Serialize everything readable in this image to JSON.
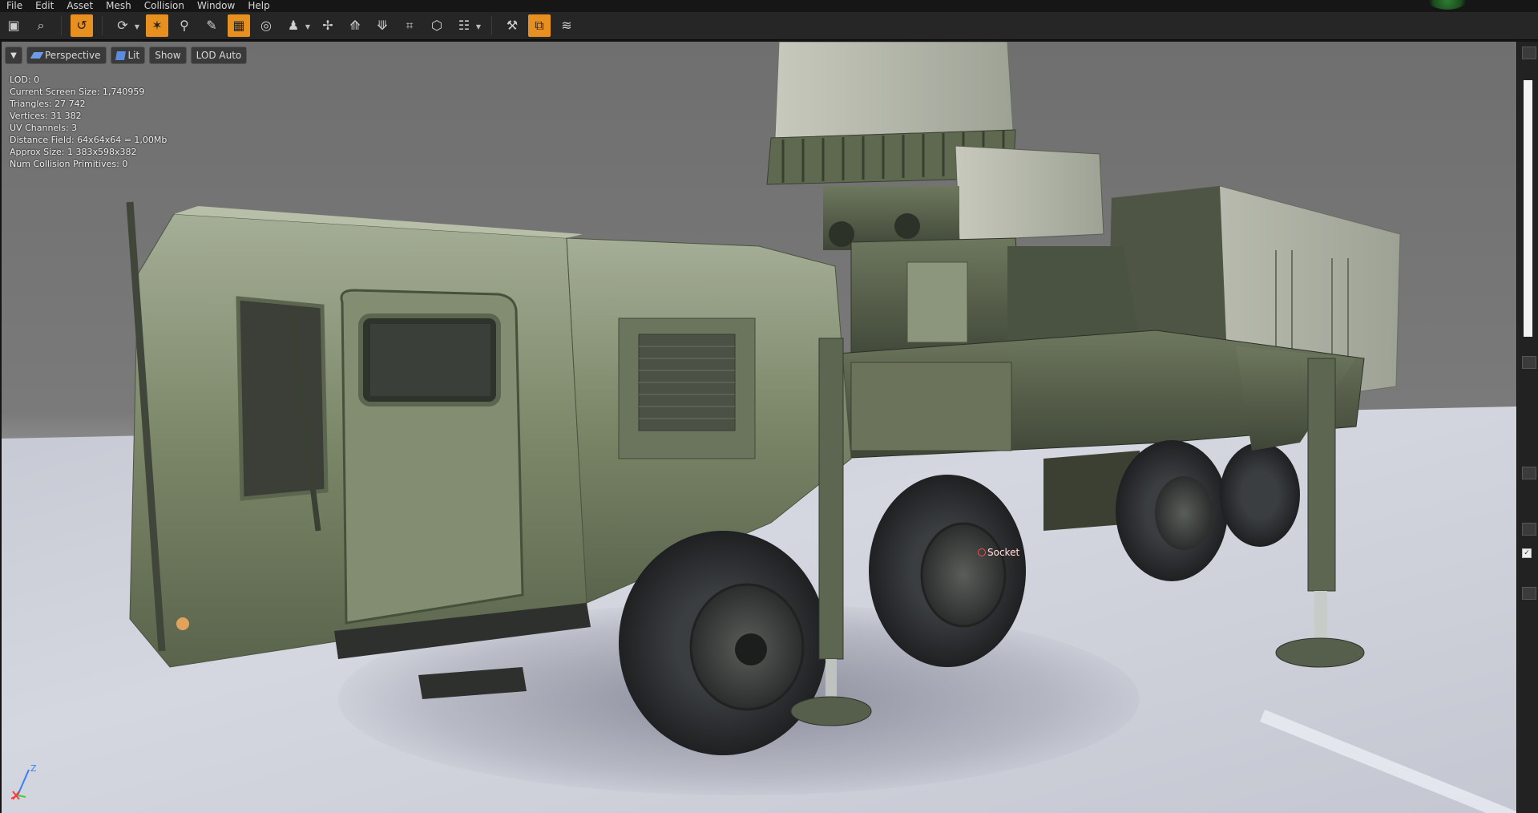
{
  "menu": [
    "File",
    "Edit",
    "Asset",
    "Mesh",
    "Collision",
    "Window",
    "Help"
  ],
  "toolbar": {
    "buttons": [
      {
        "name": "save-icon",
        "glyph": "▣",
        "active": false
      },
      {
        "name": "find-in-content-browser-icon",
        "glyph": "⌕",
        "active": false
      },
      {
        "name": "reimport-icon",
        "glyph": "↺",
        "active": true
      },
      {
        "name": "camera-orbit-icon",
        "glyph": "⟳",
        "active": false,
        "dropdown": true
      },
      {
        "name": "sockets-icon",
        "glyph": "✶",
        "active": true
      },
      {
        "name": "pivot-icon",
        "glyph": "⚲",
        "active": false
      },
      {
        "name": "edit-paint-icon",
        "glyph": "✎",
        "active": false
      },
      {
        "name": "grid-icon",
        "glyph": "▦",
        "active": true
      },
      {
        "name": "bounds-icon",
        "glyph": "◎",
        "active": false
      },
      {
        "name": "collision-icon",
        "glyph": "♟",
        "active": false,
        "dropdown": true
      },
      {
        "name": "normals-icon",
        "glyph": "✢",
        "active": false
      },
      {
        "name": "tangents-icon",
        "glyph": "⟰",
        "active": false
      },
      {
        "name": "binormals-icon",
        "glyph": "⟱",
        "active": false
      },
      {
        "name": "uv-overlay-icon",
        "glyph": "⌗",
        "active": false
      },
      {
        "name": "vertex-colors-icon",
        "glyph": "⬡",
        "active": false
      },
      {
        "name": "lod-settings-icon",
        "glyph": "☷",
        "active": false,
        "dropdown": true
      },
      {
        "name": "tools-icon",
        "glyph": "⚒",
        "active": false
      },
      {
        "name": "details-toggle-icon",
        "glyph": "⧉",
        "active": true
      },
      {
        "name": "layers-icon",
        "glyph": "≋",
        "active": false
      }
    ]
  },
  "viewport": {
    "perspective_label": "Perspective",
    "lit_label": "Lit",
    "show_label": "Show",
    "lod_label": "LOD Auto",
    "stats": [
      "LOD:  0",
      "Current Screen Size:  1,740959",
      "Triangles:  27 742",
      "Vertices:  31 382",
      "UV Channels:  3",
      "Distance Field:  64x64x64 = 1,00Mb",
      "Approx Size: 1 383x598x382",
      "Num Collision Primitives:  0"
    ],
    "axis_z_label": "Z",
    "socket_label": "Socket"
  },
  "colors": {
    "accent": "#e8901f",
    "vehicle": "#7e8a6a",
    "tire": "#2c2e30"
  }
}
